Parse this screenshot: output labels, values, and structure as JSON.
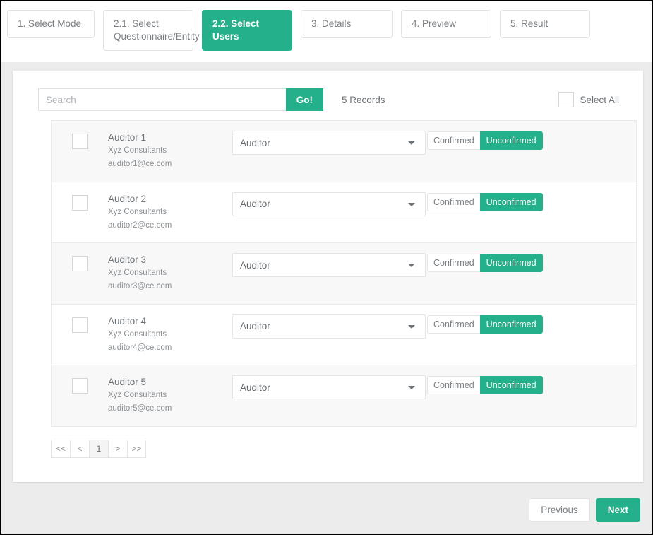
{
  "wizard": {
    "tabs": [
      {
        "label": "1. Select Mode",
        "active": false
      },
      {
        "label": "2.1. Select Questionnaire/Entity",
        "active": false
      },
      {
        "label": "2.2. Select Users",
        "active": true
      },
      {
        "label": "3. Details",
        "active": false
      },
      {
        "label": "4. Preview",
        "active": false
      },
      {
        "label": "5. Result",
        "active": false
      }
    ]
  },
  "toolbar": {
    "search_placeholder": "Search",
    "search_value": "",
    "go_label": "Go!",
    "records_text": "5 Records",
    "select_all_label": "Select All"
  },
  "users": [
    {
      "name": "Auditor 1",
      "org": "Xyz Consultants",
      "email": "auditor1@ce.com",
      "role": "Auditor",
      "status_off": "Confirmed",
      "status_on": "Unconfirmed"
    },
    {
      "name": "Auditor 2",
      "org": "Xyz Consultants",
      "email": "auditor2@ce.com",
      "role": "Auditor",
      "status_off": "Confirmed",
      "status_on": "Unconfirmed"
    },
    {
      "name": "Auditor 3",
      "org": "Xyz Consultants",
      "email": "auditor3@ce.com",
      "role": "Auditor",
      "status_off": "Confirmed",
      "status_on": "Unconfirmed"
    },
    {
      "name": "Auditor 4",
      "org": "Xyz Consultants",
      "email": "auditor4@ce.com",
      "role": "Auditor",
      "status_off": "Confirmed",
      "status_on": "Unconfirmed"
    },
    {
      "name": "Auditor 5",
      "org": "Xyz Consultants",
      "email": "auditor5@ce.com",
      "role": "Auditor",
      "status_off": "Confirmed",
      "status_on": "Unconfirmed"
    }
  ],
  "pagination": {
    "first_label": "<<",
    "prev_label": "<",
    "current_label": "1",
    "next_label": ">",
    "last_label": ">>"
  },
  "footer": {
    "previous_label": "Previous",
    "next_label": "Next"
  },
  "colors": {
    "accent": "#23b08a",
    "page_background": "#ececec",
    "card_background": "#ffffff",
    "row_alt_background": "#f8f8f8",
    "border": "#e4e4e4",
    "text": "#6d7276",
    "muted_text": "#8a8f93"
  }
}
